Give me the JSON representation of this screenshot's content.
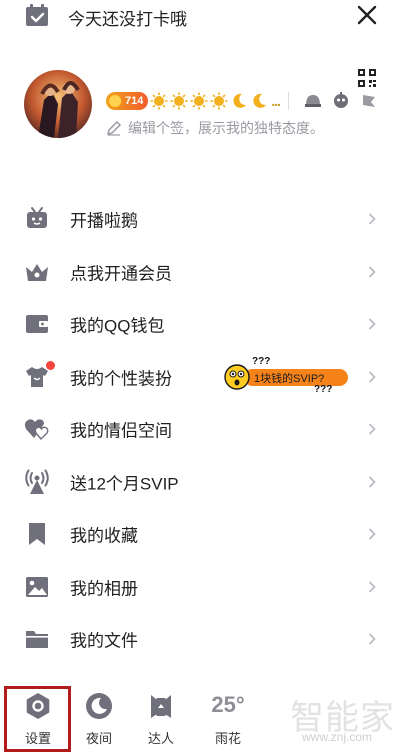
{
  "topbar": {
    "checkin_text": "今天还没打卡哦",
    "calendar_icon": "calendar-check-icon",
    "close_icon": "close-icon"
  },
  "profile": {
    "level_number": "714",
    "signature": "编辑个签，展示我的独特态度。",
    "qr_icon": "qr-code-icon"
  },
  "menu": {
    "items": [
      {
        "label": "开播啦鹅",
        "icon": "live-broadcast-icon"
      },
      {
        "label": "点我开通会员",
        "icon": "crown-icon"
      },
      {
        "label": "我的QQ钱包",
        "icon": "wallet-icon"
      },
      {
        "label": "我的个性装扮",
        "icon": "tshirt-icon",
        "promo": {
          "question_marks_top": "???",
          "text": "1块钱的SVIP?",
          "question_marks_bottom": "???"
        }
      },
      {
        "label": "我的情侣空间",
        "icon": "hearts-icon"
      },
      {
        "label": "送12个月SVIP",
        "icon": "broadcast-tower-icon"
      },
      {
        "label": "我的收藏",
        "icon": "bookmark-icon"
      },
      {
        "label": "我的相册",
        "icon": "photo-icon"
      },
      {
        "label": "我的文件",
        "icon": "folder-icon"
      }
    ]
  },
  "bottombar": {
    "settings": "设置",
    "night": "夜间",
    "expert": "达人",
    "temperature": "25°",
    "weather": "雨花"
  },
  "watermark": {
    "text": "智能家",
    "url": "www.znj.com"
  },
  "colors": {
    "icon_gray": "#70707c",
    "accent_orange": "#f6831a",
    "highlight_red": "#b01b1b"
  }
}
